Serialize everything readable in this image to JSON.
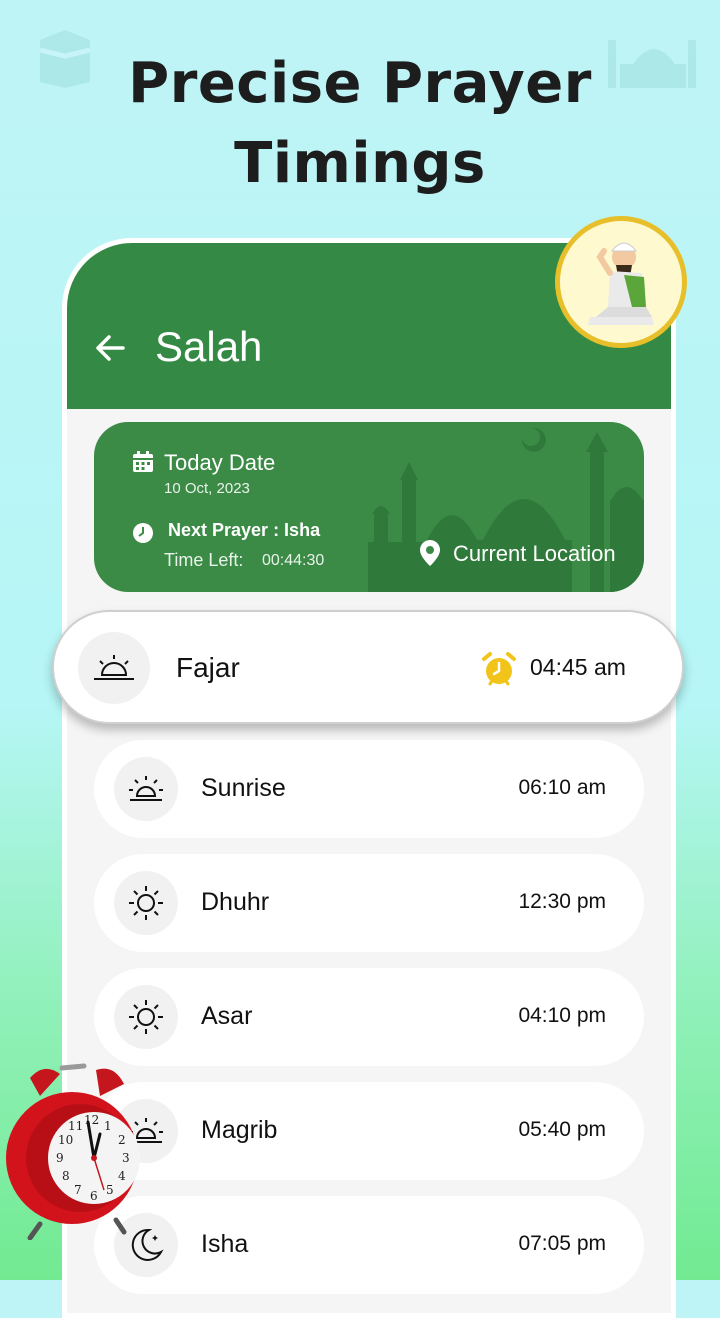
{
  "headline": {
    "line1": "Precise Prayer",
    "line2": "Timings"
  },
  "appbar": {
    "title": "Salah",
    "back_icon": "arrow-left-icon"
  },
  "info_card": {
    "today_label": "Today Date",
    "today_date": "10 Oct, 2023",
    "next_prayer": "Next Prayer : Isha",
    "time_left_label": "Time Left:",
    "time_left_value": "00:44:30",
    "location_label": "Current Location"
  },
  "prayers": [
    {
      "name": "Fajar",
      "time": "04:45 am",
      "icon": "sunrise-icon",
      "active": true
    },
    {
      "name": "Sunrise",
      "time": "06:10 am",
      "icon": "sunrise-alarm-icon"
    },
    {
      "name": "Dhuhr",
      "time": "12:30 pm",
      "icon": "sun-icon"
    },
    {
      "name": "Asar",
      "time": "04:10 pm",
      "icon": "sun-icon"
    },
    {
      "name": "Magrib",
      "time": "05:40 pm",
      "icon": "sunset-icon"
    },
    {
      "name": "Isha",
      "time": "07:05 pm",
      "icon": "moon-icon"
    }
  ],
  "colors": {
    "primary_green": "#348a44",
    "alarm_yellow": "#f2c318",
    "text": "#111111"
  }
}
